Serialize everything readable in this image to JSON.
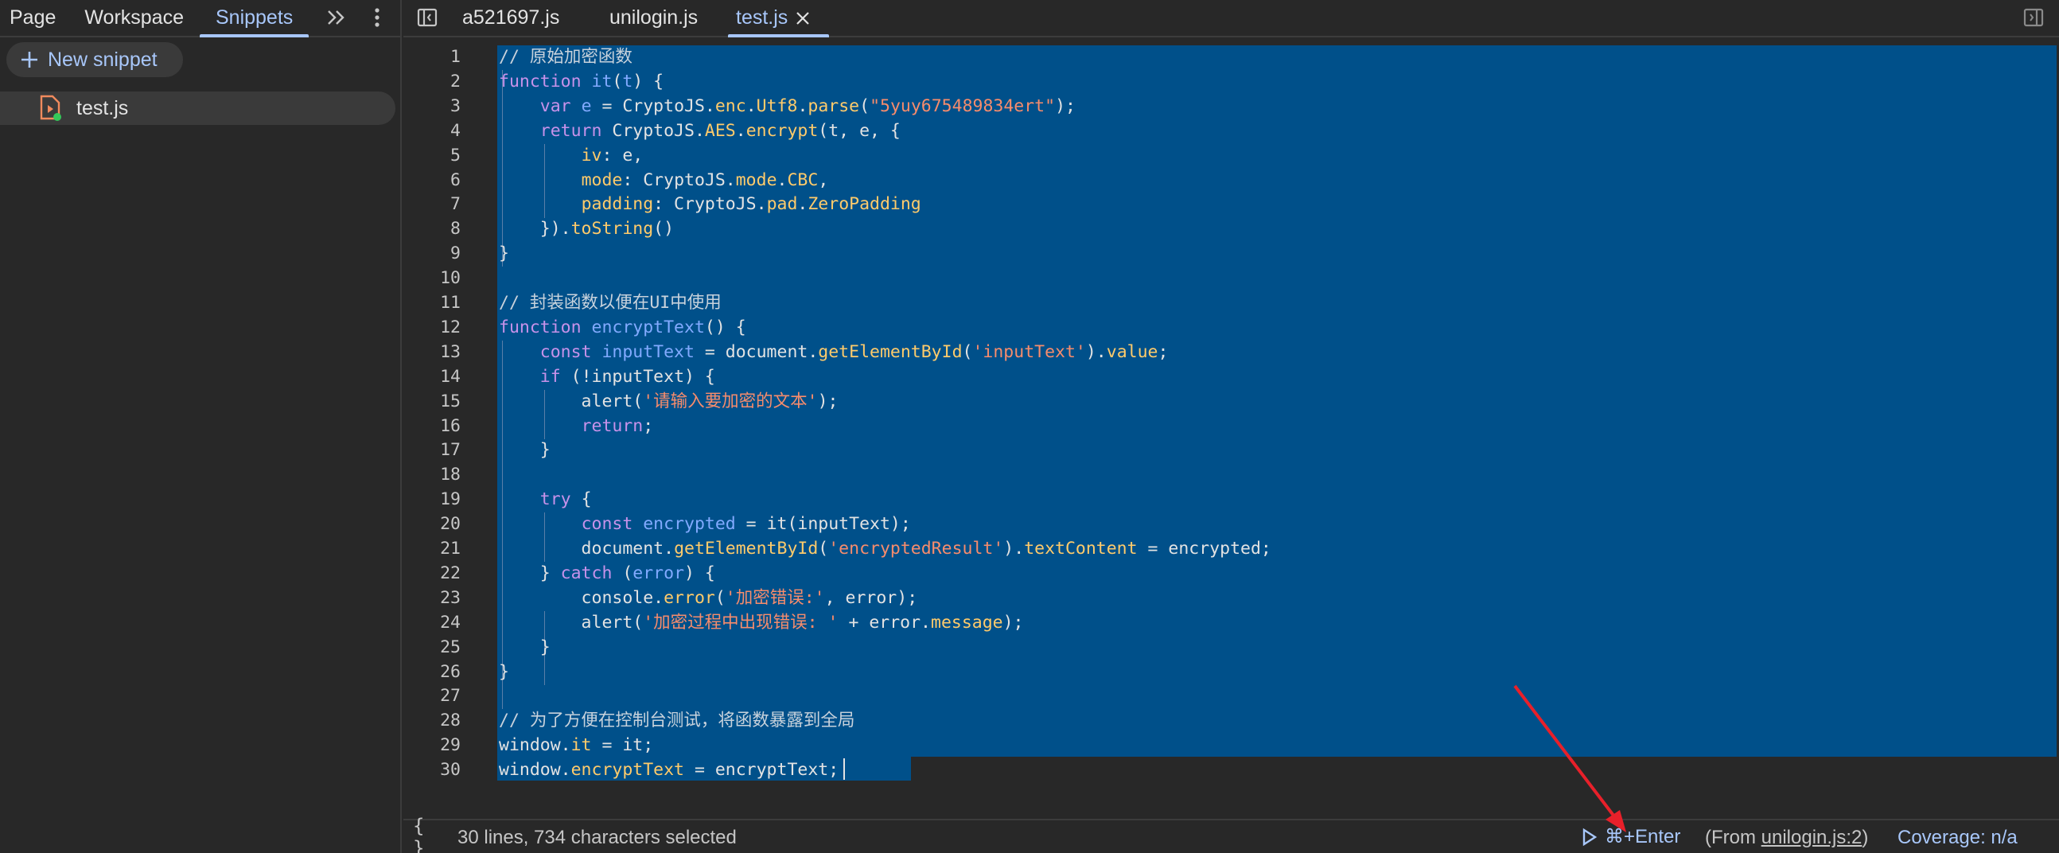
{
  "left_panel": {
    "tabs": [
      "Page",
      "Workspace",
      "Snippets"
    ],
    "new_snippet_label": "New snippet",
    "snippets": [
      {
        "name": "test.js"
      }
    ]
  },
  "editor": {
    "tabs": [
      "a521697.js",
      "unilogin.js",
      "test.js"
    ],
    "active_tab": "test.js",
    "lines": [
      [
        [
          "cm",
          "// 原始加密函数"
        ]
      ],
      [
        [
          "kw",
          "function "
        ],
        [
          "fn",
          "it"
        ],
        [
          "tx",
          "("
        ],
        [
          "fn",
          "t"
        ],
        [
          "tx",
          ") {"
        ]
      ],
      [
        [
          "tx",
          "    "
        ],
        [
          "kw",
          "var "
        ],
        [
          "fn",
          "e"
        ],
        [
          "tx",
          " = CryptoJS."
        ],
        [
          "prop",
          "enc"
        ],
        [
          "tx",
          "."
        ],
        [
          "prop",
          "Utf8"
        ],
        [
          "tx",
          "."
        ],
        [
          "prop",
          "parse"
        ],
        [
          "tx",
          "("
        ],
        [
          "str",
          "\"5yuy675489834ert\""
        ],
        [
          "tx",
          ");"
        ]
      ],
      [
        [
          "tx",
          "    "
        ],
        [
          "kw",
          "return "
        ],
        [
          "tx",
          "CryptoJS."
        ],
        [
          "prop",
          "AES"
        ],
        [
          "tx",
          "."
        ],
        [
          "prop",
          "encrypt"
        ],
        [
          "tx",
          "(t, e, {"
        ]
      ],
      [
        [
          "tx",
          "        "
        ],
        [
          "prop",
          "iv"
        ],
        [
          "tx",
          ": e,"
        ]
      ],
      [
        [
          "tx",
          "        "
        ],
        [
          "prop",
          "mode"
        ],
        [
          "tx",
          ": CryptoJS."
        ],
        [
          "prop",
          "mode"
        ],
        [
          "tx",
          "."
        ],
        [
          "prop",
          "CBC"
        ],
        [
          "tx",
          ","
        ]
      ],
      [
        [
          "tx",
          "        "
        ],
        [
          "prop",
          "padding"
        ],
        [
          "tx",
          ": CryptoJS."
        ],
        [
          "prop",
          "pad"
        ],
        [
          "tx",
          "."
        ],
        [
          "prop",
          "ZeroPadding"
        ]
      ],
      [
        [
          "tx",
          "    })."
        ],
        [
          "prop",
          "toString"
        ],
        [
          "tx",
          "()"
        ]
      ],
      [
        [
          "tx",
          "}"
        ]
      ],
      [
        [
          "tx",
          ""
        ]
      ],
      [
        [
          "cm",
          "// 封装函数以便在UI中使用"
        ]
      ],
      [
        [
          "kw",
          "function "
        ],
        [
          "fn",
          "encryptText"
        ],
        [
          "tx",
          "() {"
        ]
      ],
      [
        [
          "tx",
          "    "
        ],
        [
          "kw",
          "const "
        ],
        [
          "fn",
          "inputText"
        ],
        [
          "tx",
          " = document."
        ],
        [
          "prop",
          "getElementById"
        ],
        [
          "tx",
          "("
        ],
        [
          "str",
          "'inputText'"
        ],
        [
          "tx",
          ")."
        ],
        [
          "prop",
          "value"
        ],
        [
          "tx",
          ";"
        ]
      ],
      [
        [
          "tx",
          "    "
        ],
        [
          "kw",
          "if "
        ],
        [
          "tx",
          "(!inputText) {"
        ]
      ],
      [
        [
          "tx",
          "        alert("
        ],
        [
          "str",
          "'请输入要加密的文本'"
        ],
        [
          "tx",
          ");"
        ]
      ],
      [
        [
          "tx",
          "        "
        ],
        [
          "kw",
          "return"
        ],
        [
          "tx",
          ";"
        ]
      ],
      [
        [
          "tx",
          "    }"
        ]
      ],
      [
        [
          "tx",
          ""
        ]
      ],
      [
        [
          "tx",
          "    "
        ],
        [
          "kw",
          "try "
        ],
        [
          "tx",
          "{"
        ]
      ],
      [
        [
          "tx",
          "        "
        ],
        [
          "kw",
          "const "
        ],
        [
          "fn",
          "encrypted"
        ],
        [
          "tx",
          " = it(inputText);"
        ]
      ],
      [
        [
          "tx",
          "        document."
        ],
        [
          "prop",
          "getElementById"
        ],
        [
          "tx",
          "("
        ],
        [
          "str",
          "'encryptedResult'"
        ],
        [
          "tx",
          ")."
        ],
        [
          "prop",
          "textContent"
        ],
        [
          "tx",
          " = encrypted;"
        ]
      ],
      [
        [
          "tx",
          "    } "
        ],
        [
          "kw",
          "catch "
        ],
        [
          "tx",
          "("
        ],
        [
          "fn",
          "error"
        ],
        [
          "tx",
          ") {"
        ]
      ],
      [
        [
          "tx",
          "        console."
        ],
        [
          "prop",
          "error"
        ],
        [
          "tx",
          "("
        ],
        [
          "str",
          "'加密错误:'"
        ],
        [
          "tx",
          ", error);"
        ]
      ],
      [
        [
          "tx",
          "        alert("
        ],
        [
          "str",
          "'加密过程中出现错误: '"
        ],
        [
          "tx",
          " + error."
        ],
        [
          "prop",
          "message"
        ],
        [
          "tx",
          ");"
        ]
      ],
      [
        [
          "tx",
          "    }"
        ]
      ],
      [
        [
          "tx",
          "}"
        ]
      ],
      [
        [
          "tx",
          ""
        ]
      ],
      [
        [
          "cm",
          "// 为了方便在控制台测试，将函数暴露到全局"
        ]
      ],
      [
        [
          "tx",
          "window."
        ],
        [
          "prop",
          "it"
        ],
        [
          "tx",
          " = it;"
        ]
      ],
      [
        [
          "tx",
          "window."
        ],
        [
          "prop",
          "encryptText"
        ],
        [
          "tx",
          " = encryptText;"
        ]
      ]
    ]
  },
  "status": {
    "selection": "30 lines, 734 characters selected",
    "run_shortcut": "⌘+Enter",
    "from_prefix": "(From ",
    "from_link": "unilogin.js:2",
    "from_suffix": ")",
    "coverage": "Coverage: n/a"
  },
  "colors": {
    "accent": "#a8c7fa",
    "selection": "#00508a",
    "annotation_arrow": "#e8202a"
  }
}
